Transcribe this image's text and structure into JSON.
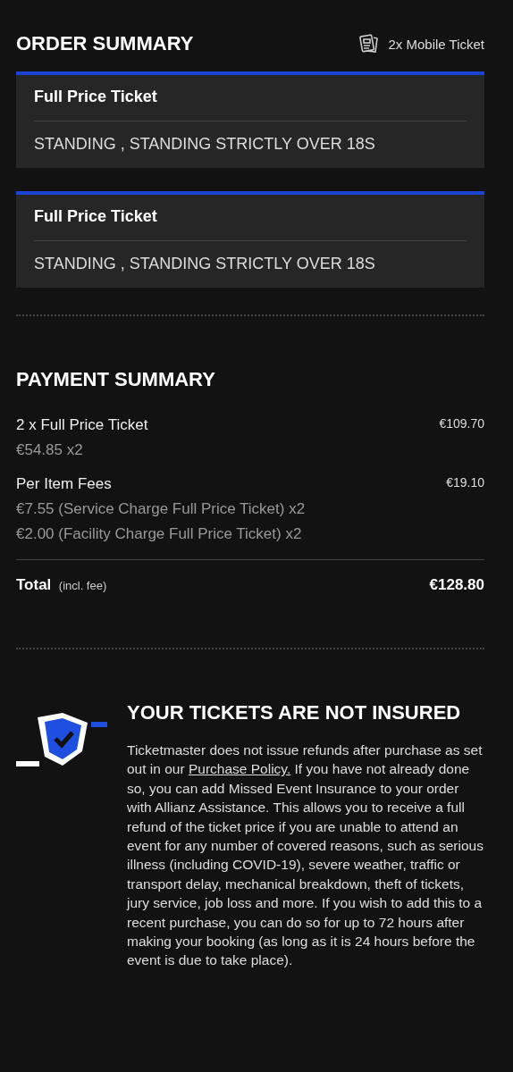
{
  "order_summary": {
    "title": "ORDER SUMMARY",
    "delivery": "2x Mobile Ticket",
    "tickets": [
      {
        "name": "Full Price Ticket",
        "section": "STANDING , STANDING STRICTLY OVER 18S"
      },
      {
        "name": "Full Price Ticket",
        "section": "STANDING , STANDING STRICTLY OVER 18S"
      }
    ]
  },
  "payment_summary": {
    "title": "PAYMENT SUMMARY",
    "items": [
      {
        "label": "2 x Full Price Ticket",
        "amount": "€109.70",
        "details": [
          "€54.85 x2"
        ]
      },
      {
        "label": "Per Item Fees",
        "amount": "€19.10",
        "details": [
          "€7.55 (Service Charge Full Price Ticket) x2",
          "€2.00 (Facility Charge Full Price Ticket) x2"
        ]
      }
    ],
    "total": {
      "label": "Total",
      "note": "(incl. fee)",
      "amount": "€128.80"
    }
  },
  "insurance": {
    "title": "YOUR TICKETS ARE NOT INSURED",
    "text_before": "Ticketmaster does not issue refunds after purchase as set out in our",
    "link": "Purchase Policy.",
    "text_after": "If you have not already done so, you can add Missed Event Insurance to your order with Allianz Assistance. This allows you to receive a full refund of the ticket price if you are unable to attend an event for any number of covered reasons, such as serious illness (including COVID-19), severe weather, traffic or transport delay, mechanical breakdown, theft of tickets, jury service, job loss and more. If you wish to add this to a recent purchase, you can do so for up to 72 hours after making your booking (as long as it is 24 hours before the event is due to take place)."
  }
}
